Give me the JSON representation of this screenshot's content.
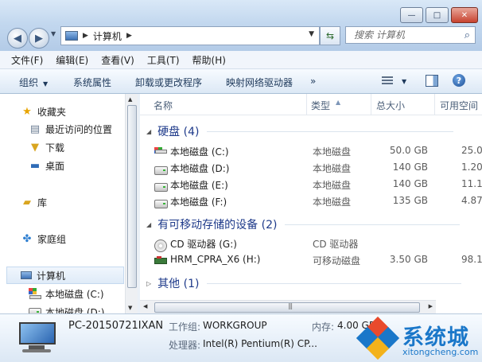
{
  "window": {
    "controls": {
      "minimize": "—",
      "maximize": "□",
      "close": "✕"
    }
  },
  "address": {
    "crumbs": [
      "计算机"
    ],
    "search_placeholder": "搜索 计算机"
  },
  "menu": [
    "文件(F)",
    "编辑(E)",
    "查看(V)",
    "工具(T)",
    "帮助(H)"
  ],
  "toolbar": {
    "organize": "组织",
    "system_properties": "系统属性",
    "uninstall": "卸载或更改程序",
    "map_drive": "映射网络驱动器",
    "more": "»"
  },
  "nav": {
    "favorites": "收藏夹",
    "recent": "最近访问的位置",
    "downloads": "下载",
    "desktop": "桌面",
    "libraries": "库",
    "homegroup": "家庭组",
    "computer": "计算机",
    "drive_c": "本地磁盘 (C:)",
    "drive_d": "本地磁盘 (D:)"
  },
  "columns": {
    "name": "名称",
    "type": "类型",
    "total": "总大小",
    "free": "可用空间"
  },
  "groups": {
    "hard_disks": "硬盘 (4)",
    "removable": "有可移动存储的设备 (2)",
    "other": "其他 (1)"
  },
  "drives": [
    {
      "name": "本地磁盘 (C:)",
      "type": "本地磁盘",
      "total": "50.0 GB",
      "free": "25.0"
    },
    {
      "name": "本地磁盘 (D:)",
      "type": "本地磁盘",
      "total": "140 GB",
      "free": "1.20"
    },
    {
      "name": "本地磁盘 (E:)",
      "type": "本地磁盘",
      "total": "140 GB",
      "free": "11.1"
    },
    {
      "name": "本地磁盘 (F:)",
      "type": "本地磁盘",
      "total": "135 GB",
      "free": "4.87"
    }
  ],
  "removable": [
    {
      "name": "CD 驱动器 (G:)",
      "type": "CD 驱动器",
      "total": "",
      "free": ""
    },
    {
      "name": "HRM_CPRA_X6 (H:)",
      "type": "可移动磁盘",
      "total": "3.50 GB",
      "free": "98.1"
    }
  ],
  "details": {
    "pc_name": "PC-20150721IXAN",
    "workgroup_label": "工作组:",
    "workgroup": "WORKGROUP",
    "memory_label": "内存:",
    "memory": "4.00 GB",
    "cpu_label": "处理器:",
    "cpu": "Intel(R) Pentium(R) CP..."
  },
  "watermark": {
    "brand": "系统城",
    "url": "xitongcheng.com"
  },
  "colors": {
    "group_header": "#1e3a8a",
    "accent": "#1a77c9"
  }
}
